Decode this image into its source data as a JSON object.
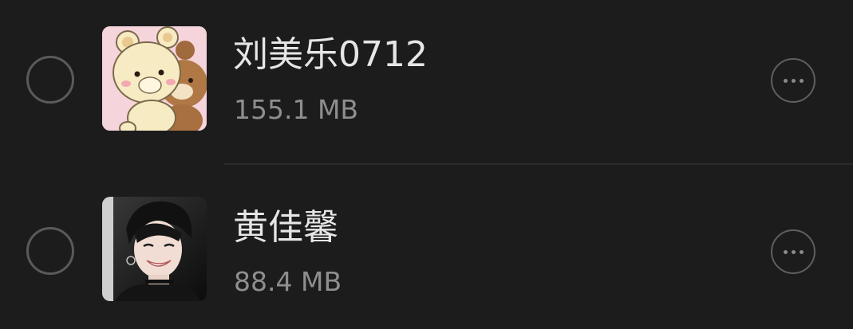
{
  "files": [
    {
      "name": "刘美乐0712",
      "size": "155.1 MB",
      "avatar_icon": "cartoon-bears-avatar-icon"
    },
    {
      "name": "黄佳馨",
      "size": "88.4 MB",
      "avatar_icon": "person-photo-avatar-icon"
    }
  ],
  "colors": {
    "background": "#1c1c1c",
    "name_text": "#e6e6e6",
    "size_text": "#8e8e8e",
    "circle_border": "#5a5a5a"
  }
}
